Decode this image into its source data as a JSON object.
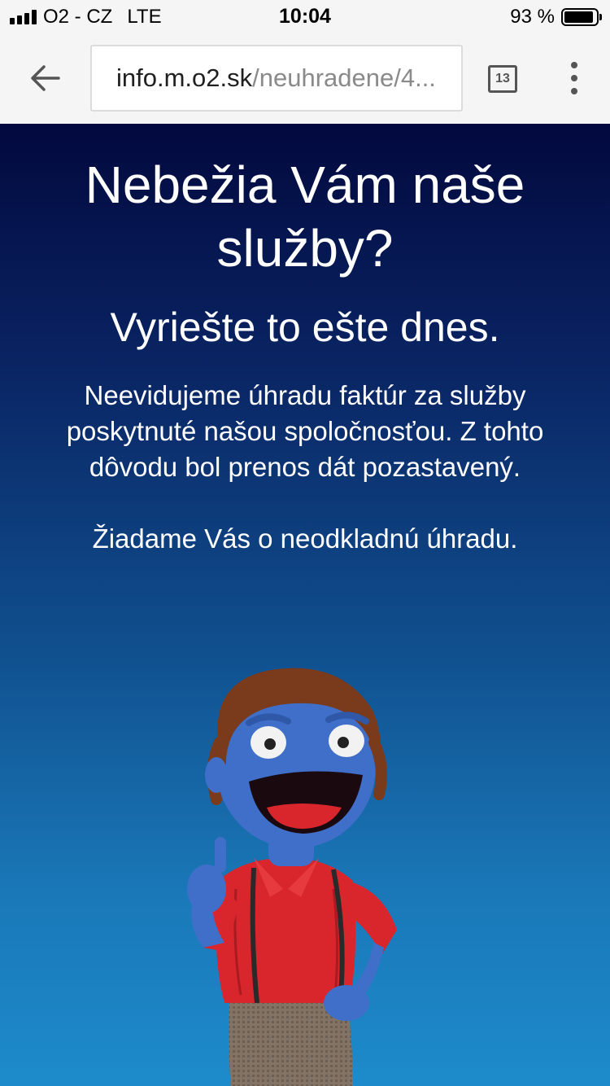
{
  "status_bar": {
    "carrier": "O2 - CZ",
    "network": "LTE",
    "time": "10:04",
    "battery_percent": "93 %",
    "battery_level": 0.93
  },
  "browser": {
    "url_host": "info.m.o2.sk",
    "url_path": "/neuhradene/4...",
    "tab_count": "13",
    "icons": {
      "back": "arrow-left-icon",
      "tabs": "tab-switcher-icon",
      "menu": "more-vert-icon"
    }
  },
  "page": {
    "headline": "Nebežia Vám naše služby?",
    "subheadline": "Vyriešte to ešte dnes.",
    "body": "Neevidujeme úhradu faktúr za služby poskytnuté našou spoločnosťou. Z tohto dôvodu bol prenos dát pozastavený.",
    "request": "Žiadame Vás o neodkladnú úhradu.",
    "colors": {
      "gradient_top": "#02093e",
      "gradient_bottom": "#1d8bcb",
      "mascot_skin": "#3f6fc8",
      "mascot_shirt": "#d9262c",
      "mascot_hair": "#7a3a1c"
    }
  }
}
